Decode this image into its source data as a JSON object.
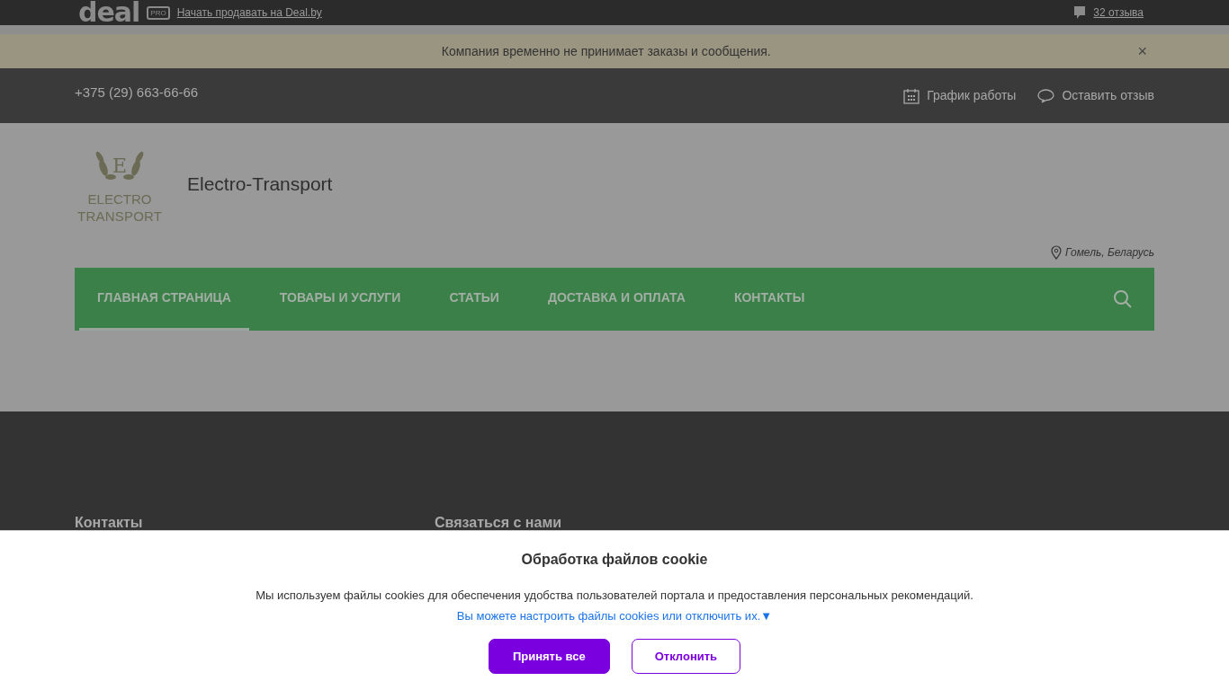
{
  "topbar": {
    "logo": "deal",
    "badge": "PRO",
    "sell_link": "Начать продавать на Deal.by",
    "reviews_link": "32 отзыва"
  },
  "notice": {
    "text": "Компания временно не принимает заказы и сообщения.",
    "close": "×"
  },
  "header": {
    "phone": "+375 (29) 663-66-66",
    "schedule": "График работы",
    "review": "Оставить отзыв"
  },
  "company": {
    "logo": {
      "letter": "E",
      "lines": [
        "ELECTRO",
        "TRANSPORT"
      ]
    },
    "name": "Electro-Transport",
    "location": "Гомель, Беларусь"
  },
  "nav": [
    {
      "label": "ГЛАВНАЯ СТРАНИЦА",
      "selected": true
    },
    {
      "label": "ТОВАРЫ И УСЛУГИ",
      "selected": false
    },
    {
      "label": "СТАТЬИ",
      "selected": false
    },
    {
      "label": "ДОСТАВКА И ОПЛАТА",
      "selected": false
    },
    {
      "label": "КОНТАКТЫ",
      "selected": false
    }
  ],
  "footer": {
    "headings": [
      "Контакты",
      "Связаться с нами"
    ]
  },
  "cookie": {
    "title": "Обработка файлов cookie",
    "text": "Мы используем файлы cookies для обеспечения удобства пользователей портала и предоставления персональных рекомендаций.",
    "settings_link": "Вы можете настроить файлы cookies или отключить их.▼",
    "accept": "Принять все",
    "decline": "Отклонить"
  }
}
